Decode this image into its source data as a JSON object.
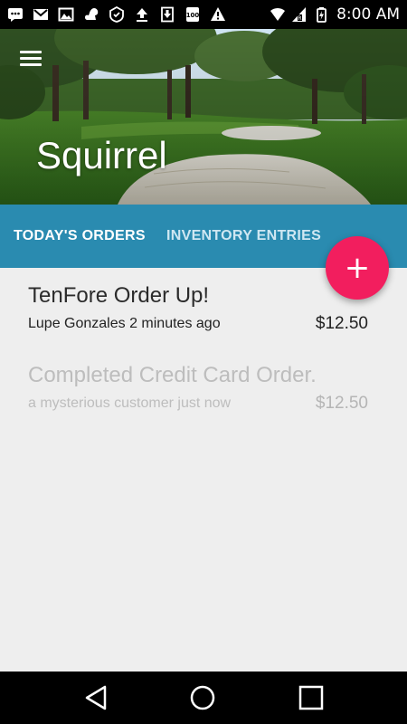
{
  "status_bar": {
    "time": "8:00 AM",
    "left_icons": [
      "messages-icon",
      "gmail-icon",
      "photo-icon",
      "squirrel-icon",
      "battery-saver-icon",
      "upload-icon",
      "download-icon",
      "badge-100-icon",
      "warning-icon"
    ],
    "badge_text": "100"
  },
  "header": {
    "app_title": "Squirrel",
    "menu_icon": "hamburger-menu-icon"
  },
  "tabs": [
    {
      "label": "TODAY'S ORDERS",
      "selected": true
    },
    {
      "label": "INVENTORY ENTRIES",
      "selected": false
    }
  ],
  "fab": {
    "label": "+"
  },
  "orders": [
    {
      "title": "TenFore Order Up!",
      "subtitle": "Lupe Gonzales 2 minutes ago",
      "price": "$12.50",
      "state": "active"
    },
    {
      "title": "Completed Credit Card Order.",
      "subtitle": "a mysterious customer just now",
      "price": "$12.50",
      "state": "completed"
    }
  ],
  "colors": {
    "tab_bar": "#2a8bb0",
    "fab": "#f21e5e",
    "background": "#eeeeee"
  },
  "nav_bar": {
    "buttons": [
      "back-icon",
      "home-icon",
      "recents-icon"
    ]
  }
}
